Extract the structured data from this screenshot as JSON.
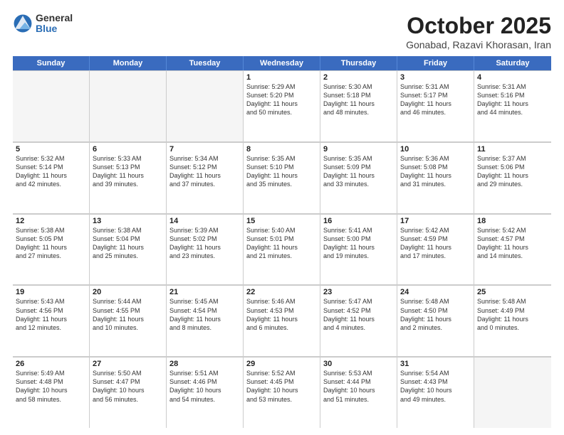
{
  "logo": {
    "general": "General",
    "blue": "Blue"
  },
  "title": "October 2025",
  "location": "Gonabad, Razavi Khorasan, Iran",
  "header_days": [
    "Sunday",
    "Monday",
    "Tuesday",
    "Wednesday",
    "Thursday",
    "Friday",
    "Saturday"
  ],
  "rows": [
    [
      {
        "day": "",
        "content": ""
      },
      {
        "day": "",
        "content": ""
      },
      {
        "day": "",
        "content": ""
      },
      {
        "day": "1",
        "content": "Sunrise: 5:29 AM\nSunset: 5:20 PM\nDaylight: 11 hours\nand 50 minutes."
      },
      {
        "day": "2",
        "content": "Sunrise: 5:30 AM\nSunset: 5:18 PM\nDaylight: 11 hours\nand 48 minutes."
      },
      {
        "day": "3",
        "content": "Sunrise: 5:31 AM\nSunset: 5:17 PM\nDaylight: 11 hours\nand 46 minutes."
      },
      {
        "day": "4",
        "content": "Sunrise: 5:31 AM\nSunset: 5:16 PM\nDaylight: 11 hours\nand 44 minutes."
      }
    ],
    [
      {
        "day": "5",
        "content": "Sunrise: 5:32 AM\nSunset: 5:14 PM\nDaylight: 11 hours\nand 42 minutes."
      },
      {
        "day": "6",
        "content": "Sunrise: 5:33 AM\nSunset: 5:13 PM\nDaylight: 11 hours\nand 39 minutes."
      },
      {
        "day": "7",
        "content": "Sunrise: 5:34 AM\nSunset: 5:12 PM\nDaylight: 11 hours\nand 37 minutes."
      },
      {
        "day": "8",
        "content": "Sunrise: 5:35 AM\nSunset: 5:10 PM\nDaylight: 11 hours\nand 35 minutes."
      },
      {
        "day": "9",
        "content": "Sunrise: 5:35 AM\nSunset: 5:09 PM\nDaylight: 11 hours\nand 33 minutes."
      },
      {
        "day": "10",
        "content": "Sunrise: 5:36 AM\nSunset: 5:08 PM\nDaylight: 11 hours\nand 31 minutes."
      },
      {
        "day": "11",
        "content": "Sunrise: 5:37 AM\nSunset: 5:06 PM\nDaylight: 11 hours\nand 29 minutes."
      }
    ],
    [
      {
        "day": "12",
        "content": "Sunrise: 5:38 AM\nSunset: 5:05 PM\nDaylight: 11 hours\nand 27 minutes."
      },
      {
        "day": "13",
        "content": "Sunrise: 5:38 AM\nSunset: 5:04 PM\nDaylight: 11 hours\nand 25 minutes."
      },
      {
        "day": "14",
        "content": "Sunrise: 5:39 AM\nSunset: 5:02 PM\nDaylight: 11 hours\nand 23 minutes."
      },
      {
        "day": "15",
        "content": "Sunrise: 5:40 AM\nSunset: 5:01 PM\nDaylight: 11 hours\nand 21 minutes."
      },
      {
        "day": "16",
        "content": "Sunrise: 5:41 AM\nSunset: 5:00 PM\nDaylight: 11 hours\nand 19 minutes."
      },
      {
        "day": "17",
        "content": "Sunrise: 5:42 AM\nSunset: 4:59 PM\nDaylight: 11 hours\nand 17 minutes."
      },
      {
        "day": "18",
        "content": "Sunrise: 5:42 AM\nSunset: 4:57 PM\nDaylight: 11 hours\nand 14 minutes."
      }
    ],
    [
      {
        "day": "19",
        "content": "Sunrise: 5:43 AM\nSunset: 4:56 PM\nDaylight: 11 hours\nand 12 minutes."
      },
      {
        "day": "20",
        "content": "Sunrise: 5:44 AM\nSunset: 4:55 PM\nDaylight: 11 hours\nand 10 minutes."
      },
      {
        "day": "21",
        "content": "Sunrise: 5:45 AM\nSunset: 4:54 PM\nDaylight: 11 hours\nand 8 minutes."
      },
      {
        "day": "22",
        "content": "Sunrise: 5:46 AM\nSunset: 4:53 PM\nDaylight: 11 hours\nand 6 minutes."
      },
      {
        "day": "23",
        "content": "Sunrise: 5:47 AM\nSunset: 4:52 PM\nDaylight: 11 hours\nand 4 minutes."
      },
      {
        "day": "24",
        "content": "Sunrise: 5:48 AM\nSunset: 4:50 PM\nDaylight: 11 hours\nand 2 minutes."
      },
      {
        "day": "25",
        "content": "Sunrise: 5:48 AM\nSunset: 4:49 PM\nDaylight: 11 hours\nand 0 minutes."
      }
    ],
    [
      {
        "day": "26",
        "content": "Sunrise: 5:49 AM\nSunset: 4:48 PM\nDaylight: 10 hours\nand 58 minutes."
      },
      {
        "day": "27",
        "content": "Sunrise: 5:50 AM\nSunset: 4:47 PM\nDaylight: 10 hours\nand 56 minutes."
      },
      {
        "day": "28",
        "content": "Sunrise: 5:51 AM\nSunset: 4:46 PM\nDaylight: 10 hours\nand 54 minutes."
      },
      {
        "day": "29",
        "content": "Sunrise: 5:52 AM\nSunset: 4:45 PM\nDaylight: 10 hours\nand 53 minutes."
      },
      {
        "day": "30",
        "content": "Sunrise: 5:53 AM\nSunset: 4:44 PM\nDaylight: 10 hours\nand 51 minutes."
      },
      {
        "day": "31",
        "content": "Sunrise: 5:54 AM\nSunset: 4:43 PM\nDaylight: 10 hours\nand 49 minutes."
      },
      {
        "day": "",
        "content": ""
      }
    ]
  ]
}
